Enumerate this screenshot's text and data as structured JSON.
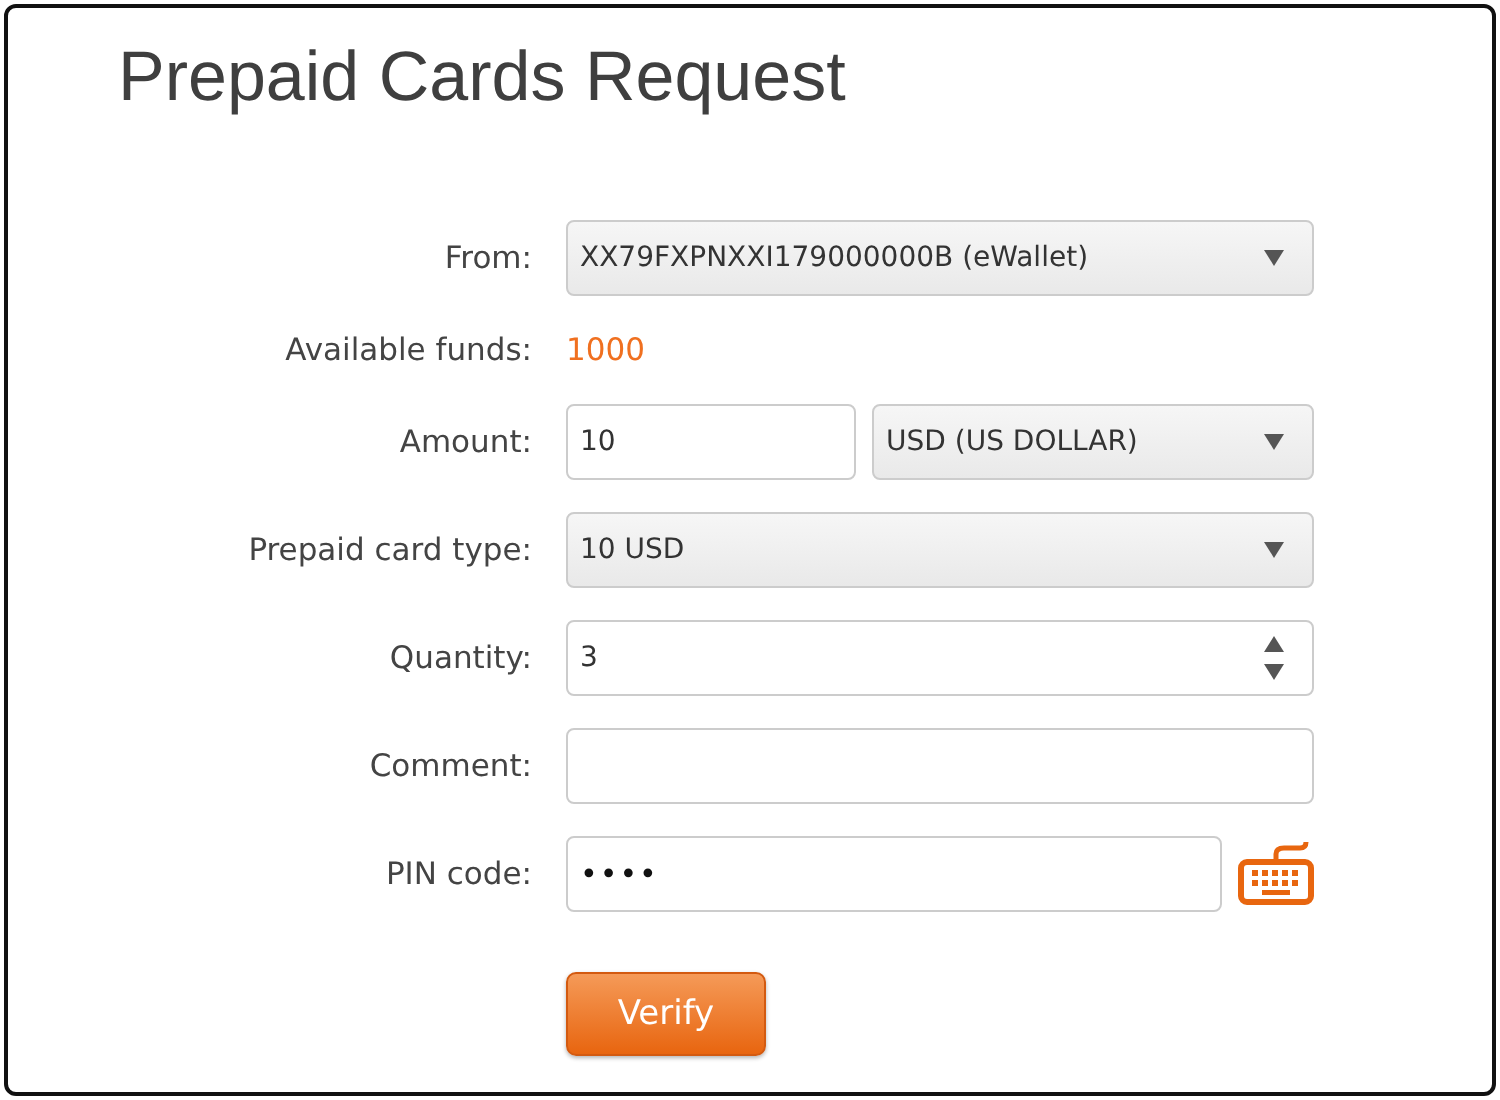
{
  "title": "Prepaid Cards Request",
  "fields": [
    {
      "kind": "select",
      "label": "From:",
      "value": "XX79FXPNXXI179000000B (eWallet)"
    },
    {
      "kind": "funds",
      "label": "Available funds:",
      "value": "1000"
    },
    {
      "kind": "amount",
      "label": "Amount:",
      "value": "10",
      "currency": "USD (US DOLLAR)"
    },
    {
      "kind": "select",
      "label": "Prepaid card type:",
      "value": "10 USD"
    },
    {
      "kind": "number",
      "label": "Quantity:",
      "value": "3"
    },
    {
      "kind": "text",
      "label": "Comment:"
    },
    {
      "kind": "password",
      "label": "PIN code:",
      "value": "••••"
    }
  ],
  "button": "Verify"
}
